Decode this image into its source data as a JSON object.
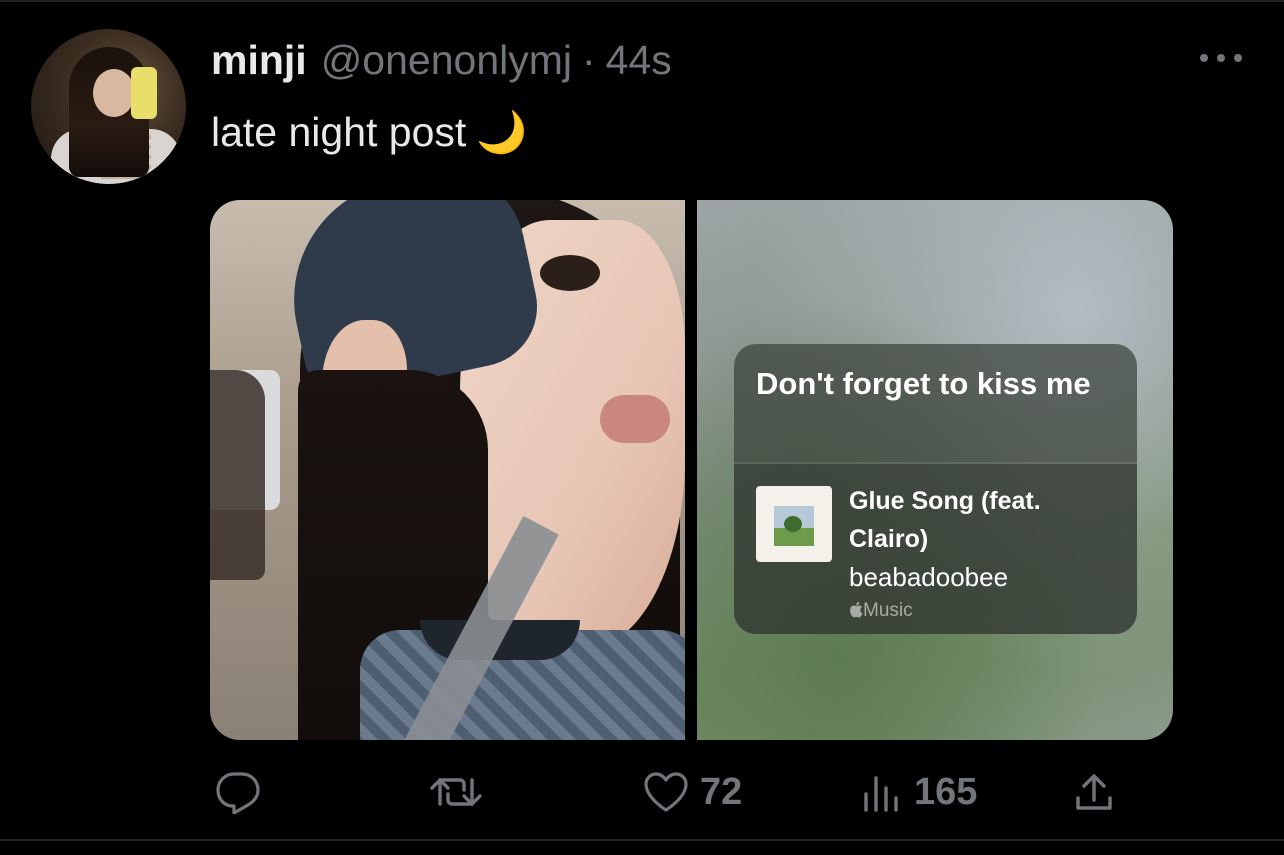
{
  "user": {
    "name": "minji",
    "handle": "@onenonlymj",
    "separator": "·",
    "time": "44s"
  },
  "tweet": {
    "text": "late night post",
    "emoji": "🌙"
  },
  "music_card": {
    "title": "Don't forget to kiss me",
    "track": {
      "title": "Glue Song (feat. Clairo)",
      "artist": "beabadoobee",
      "source": "Music",
      "source_icon": "apple-icon"
    }
  },
  "actions": {
    "reply": {
      "icon": "reply-icon"
    },
    "retweet": {
      "icon": "retweet-icon"
    },
    "like": {
      "icon": "heart-icon",
      "count": "72"
    },
    "views": {
      "icon": "views-icon",
      "count": "165"
    },
    "share": {
      "icon": "share-icon"
    }
  },
  "colors": {
    "background": "#000000",
    "text": "#e7e9ea",
    "muted": "#71767b"
  }
}
